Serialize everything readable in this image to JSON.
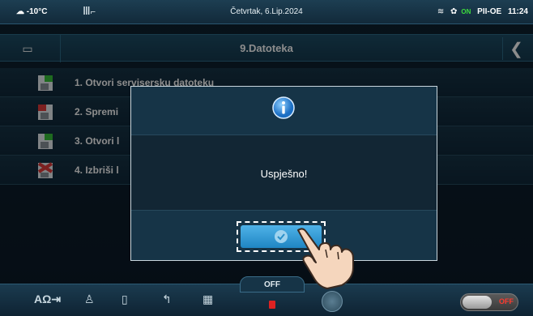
{
  "status": {
    "temperature": "-10°C",
    "date": "Četvrtak, 6.Lip.2024",
    "on_badge": "ON",
    "mode": "PII-OE",
    "time": "11:24"
  },
  "header": {
    "title": "9.Datoteka",
    "back_icon": "chevron-left-icon",
    "folder_icon": "folder-icon"
  },
  "list": {
    "items": [
      {
        "label": "1. Otvori servisersku datoteku",
        "icon": "open-file-icon",
        "accent": "#37c23a"
      },
      {
        "label": "2. Spremi",
        "icon": "save-file-icon",
        "accent": "#e23b3b"
      },
      {
        "label": "3. Otvori l",
        "icon": "open-file-icon",
        "accent": "#37c23a"
      },
      {
        "label": "4. Izbriši l",
        "icon": "delete-file-icon",
        "accent": "#e23b3b"
      }
    ]
  },
  "dialog": {
    "icon": "info-icon",
    "message": "Uspješno!",
    "ok_icon": "checkmark-icon"
  },
  "bottombar": {
    "off_tab": "OFF",
    "toggle_label": "OFF"
  },
  "colors": {
    "accent_blue": "#2a95d4",
    "off_red": "#ff3a2e",
    "on_green": "#3ddc3d"
  }
}
